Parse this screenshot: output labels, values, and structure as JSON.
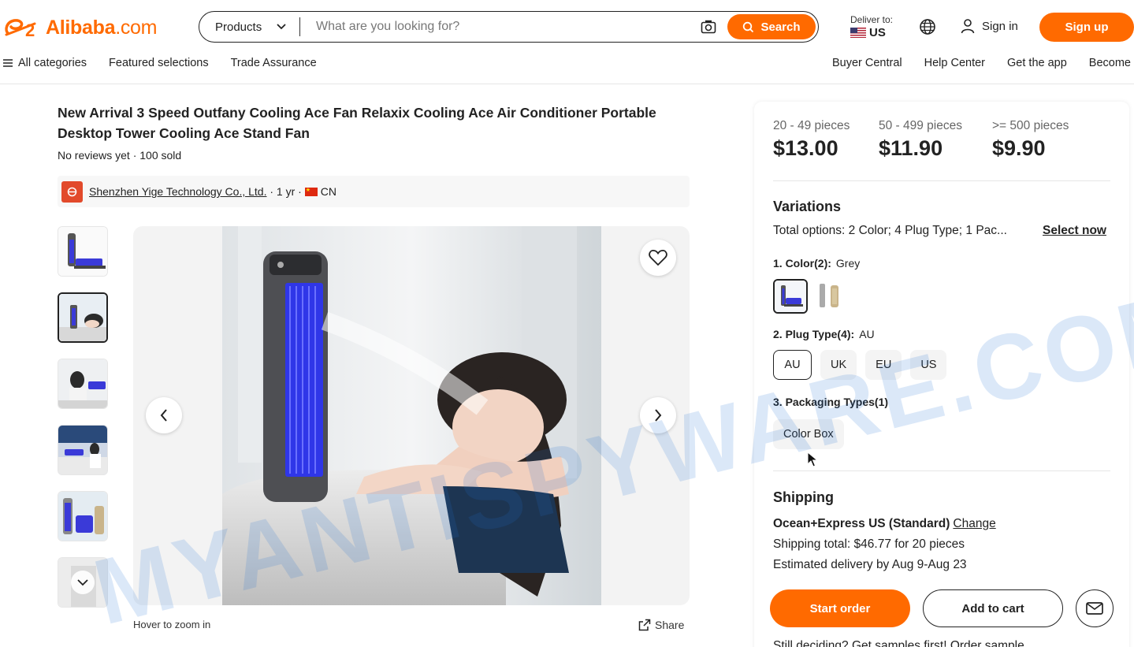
{
  "header": {
    "logo_text": "Alibaba",
    "logo_suffix": ".com",
    "search_category": "Products",
    "search_placeholder": "What are you looking for?",
    "search_button": "Search",
    "deliver_label": "Deliver to:",
    "deliver_country": "US",
    "signin": "Sign in",
    "signup": "Sign up",
    "accent_color": "#ff6a00"
  },
  "subnav": {
    "left": [
      "All categories",
      "Featured selections",
      "Trade Assurance"
    ],
    "right": [
      "Buyer Central",
      "Help Center",
      "Get the app",
      "Become"
    ]
  },
  "product": {
    "title": "New Arrival 3 Speed Outfany Cooling Ace Fan Relaxix Cooling Ace Air Conditioner Portable Desktop Tower Cooling Ace Stand Fan",
    "meta": "No reviews yet · 100 sold",
    "supplier_name": "Shenzhen Yige Technology Co., Ltd.",
    "supplier_years": " · 1 yr · ",
    "supplier_country": "CN",
    "hover_zoom": "Hover to zoom in",
    "share": "Share"
  },
  "pricing": {
    "tiers": [
      {
        "range": "20 - 49 pieces",
        "price": "$13.00"
      },
      {
        "range": "50 - 499 pieces",
        "price": "$11.90"
      },
      {
        "range": ">= 500 pieces",
        "price": "$9.90"
      }
    ]
  },
  "variations": {
    "heading": "Variations",
    "total_options": "Total options: 2 Color; 4 Plug Type; 1 Pac...",
    "select_now": "Select now",
    "color_label": "1. Color(2):",
    "color_selected": "Grey",
    "plug_label": "2. Plug Type(4):",
    "plug_selected": "AU",
    "plug_options": [
      "AU",
      "UK",
      "EU",
      "US"
    ],
    "packaging_label": "3. Packaging Types(1)",
    "packaging_options": [
      "Color Box"
    ]
  },
  "shipping": {
    "heading": "Shipping",
    "method": "Ocean+Express US (Standard)",
    "change": "Change",
    "total": "Shipping total: $46.77 for 20 pieces",
    "delivery": "Estimated delivery by Aug 9-Aug 23",
    "start_order": "Start order",
    "add_to_cart": "Add to cart",
    "samples": "Still deciding? Get samples first! Order sample"
  },
  "watermark": "MYANTISPYWARE.COM"
}
